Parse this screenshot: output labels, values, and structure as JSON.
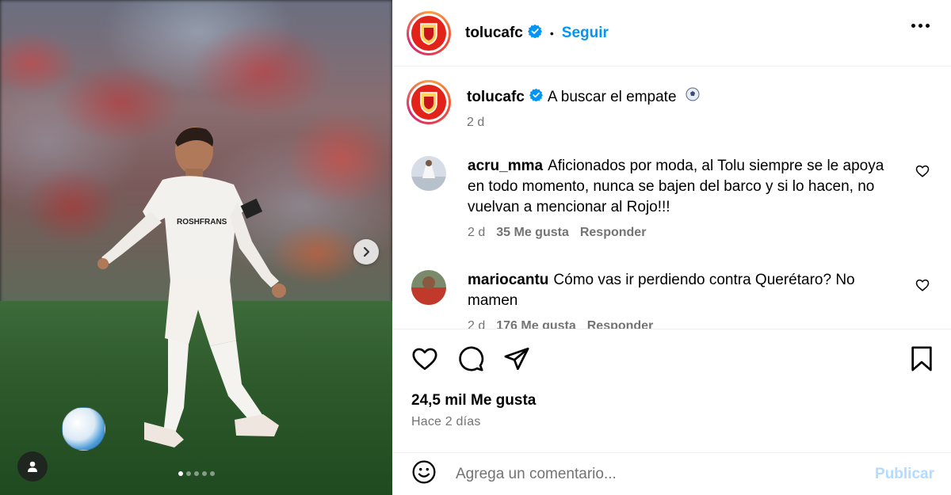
{
  "post": {
    "username": "tolucafc",
    "follow_label": "Seguir",
    "separator": "•",
    "caption": "A buscar el empate",
    "caption_age": "2 d",
    "likes": "24,5 mil Me gusta",
    "posted": "Hace 2 días",
    "media_dots": 5,
    "active_dot": 0
  },
  "comments": [
    {
      "username": "acru_mma",
      "text": "Aficionados por moda, al Tolu siempre se le apoya en todo momento, nunca se bajen del barco y si lo hacen, no vuelvan a mencionar al Rojo!!!",
      "age": "2 d",
      "likes": "35 Me gusta",
      "reply": "Responder"
    },
    {
      "username": "mariocantu",
      "text": "Cómo vas ir perdiendo contra Querétaro? No mamen",
      "age": "2 d",
      "likes": "176 Me gusta",
      "reply": "Responder"
    }
  ],
  "composer": {
    "placeholder": "Agrega un comentario...",
    "publish_label": "Publicar"
  },
  "icons": {
    "verified": "verified-badge-icon",
    "more": "more-options-icon",
    "like": "heart-icon",
    "comment": "comment-bubble-icon",
    "share": "share-paper-plane-icon",
    "save": "bookmark-icon",
    "emoji": "emoji-icon",
    "next": "chevron-right-icon",
    "tags": "user-tag-icon",
    "soccer": "soccer-ball-emoji"
  },
  "colors": {
    "accent": "#0095f6",
    "muted": "#737373",
    "publish_disabled": "#b3dbff",
    "brand_red": "#e2231a"
  }
}
